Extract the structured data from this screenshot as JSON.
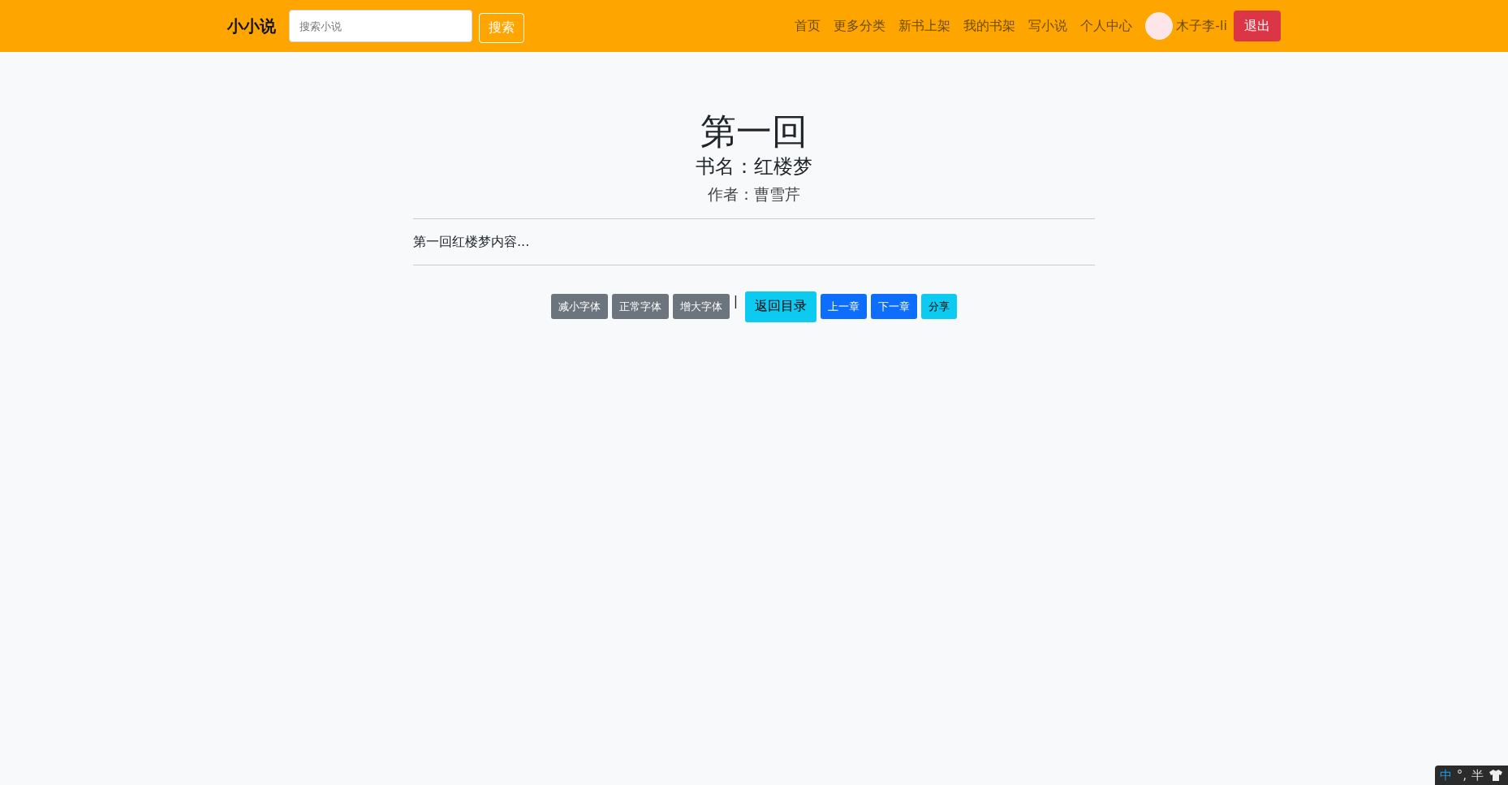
{
  "navbar": {
    "brand": "小小说",
    "search": {
      "placeholder": "搜索小说",
      "button": "搜索"
    },
    "links": [
      {
        "label": "首页"
      },
      {
        "label": "更多分类"
      },
      {
        "label": "新书上架"
      },
      {
        "label": "我的书架"
      },
      {
        "label": "写小说"
      },
      {
        "label": "个人中心"
      }
    ],
    "user": {
      "name": "木子李-li"
    },
    "logout": "退出"
  },
  "chapter": {
    "title": "第一回",
    "book": "书名：红楼梦",
    "author": "作者：曹雪芹",
    "content": "第一回红楼梦内容..."
  },
  "toolbar": [
    {
      "kind": "secondary",
      "label": "减小字体"
    },
    {
      "kind": "secondary",
      "label": "正常字体"
    },
    {
      "kind": "secondary",
      "label": "增大字体"
    },
    {
      "kind": "separator",
      "label": "|"
    },
    {
      "kind": "info-large",
      "label": "返回目录"
    },
    {
      "kind": "primary",
      "label": "上一章"
    },
    {
      "kind": "primary",
      "label": "下一章"
    },
    {
      "kind": "info",
      "label": "分享"
    }
  ],
  "ime_bar": {
    "mode": "中",
    "punctuation": "°,",
    "width": "半"
  }
}
